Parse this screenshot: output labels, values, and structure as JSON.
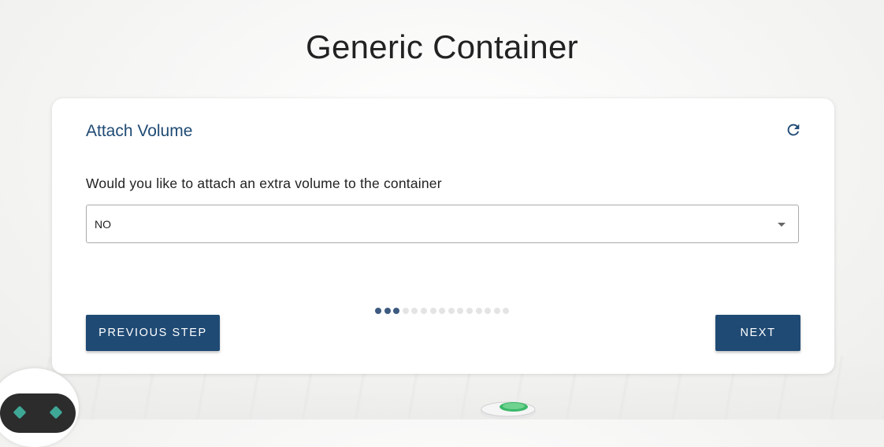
{
  "page": {
    "title": "Generic Container"
  },
  "card": {
    "title": "Attach Volume",
    "refresh_icon": "refresh-icon",
    "question": "Would you like to attach an extra volume to the container",
    "select": {
      "value": "NO",
      "caret_icon": "chevron-down-icon"
    },
    "progress": {
      "total_steps": 15,
      "completed_steps": 3
    },
    "buttons": {
      "previous_label": "PREVIOUS STEP",
      "next_label": "NEXT"
    }
  },
  "colors": {
    "accent": "#1f4a74",
    "dot_active": "#3d5a80",
    "dot_inactive": "#e4e4e4",
    "title_text": "#222222"
  }
}
